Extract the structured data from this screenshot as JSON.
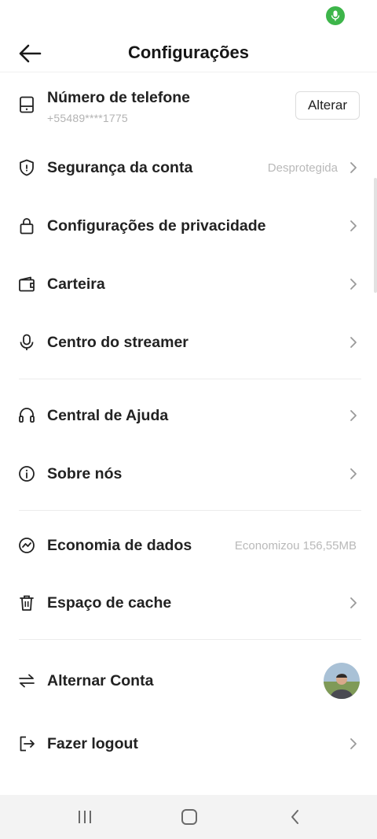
{
  "status_bar": {
    "mic_icon": "microphone-icon",
    "mic_color": "#3db54a"
  },
  "header": {
    "title": "Configurações",
    "back_icon": "arrow-left-icon"
  },
  "phone": {
    "label": "Número de telefone",
    "number": "+55489****1775",
    "change_label": "Alterar",
    "icon": "phone-icon"
  },
  "items": [
    {
      "label": "Segurança da conta",
      "value": "Desprotegida",
      "icon": "shield-icon"
    },
    {
      "label": "Configurações de privacidade",
      "icon": "lock-icon"
    },
    {
      "label": "Carteira",
      "icon": "wallet-icon"
    },
    {
      "label": "Centro do streamer",
      "icon": "microphone-icon"
    },
    {
      "label": "Central de Ajuda",
      "icon": "headset-icon"
    },
    {
      "label": "Sobre nós",
      "icon": "info-icon"
    },
    {
      "label": "Economia de dados",
      "value": "Economizou 156,55MB",
      "icon": "data-saver-icon"
    },
    {
      "label": "Espaço de cache",
      "icon": "trash-icon"
    },
    {
      "label": "Alternar Conta",
      "icon": "switch-arrows-icon"
    },
    {
      "label": "Fazer logout",
      "icon": "logout-icon"
    }
  ],
  "nav": {
    "recents_icon": "recents-icon",
    "home_icon": "home-icon",
    "back_icon": "back-icon"
  },
  "colors": {
    "accent_green": "#3db54a",
    "text": "#222222",
    "muted": "#b9b9b9"
  }
}
